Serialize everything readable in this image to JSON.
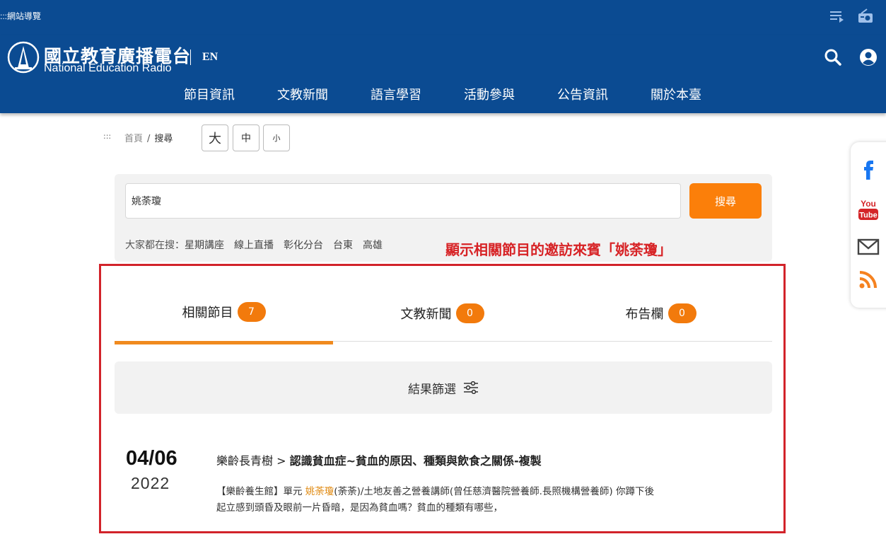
{
  "topbar": {
    "sitemap": ":::網站導覽"
  },
  "header": {
    "logo_zh": "國立教育廣播電台",
    "logo_en": "National Education Radio",
    "lang": "EN",
    "nav": [
      "節目資訊",
      "文教新聞",
      "語言學習",
      "活動參與",
      "公告資訊",
      "關於本臺"
    ]
  },
  "breadcrumb": {
    "dots": ":::",
    "home": "首頁",
    "sep": "/",
    "current": "搜尋"
  },
  "fontsize": {
    "large": "大",
    "medium": "中",
    "small": "小"
  },
  "search": {
    "value": "姚荼瓊",
    "button": "搜尋",
    "hot_label": "大家都在搜：",
    "hot_keywords": [
      "星期講座",
      "線上直播",
      "彰化分台",
      "台東",
      "高雄"
    ]
  },
  "annotation": "顯示相關節目的邀訪來賓「姚荼瓊」",
  "tabs": [
    {
      "label": "相關節目",
      "count": "7"
    },
    {
      "label": "文教新聞",
      "count": "0"
    },
    {
      "label": "布告欄",
      "count": "0"
    }
  ],
  "filter": {
    "label": "結果篩選"
  },
  "result": {
    "date_md": "04/06",
    "date_y": "2022",
    "program": "樂齡長青樹",
    "arrow": " > ",
    "title": "認識貧血症~貧血的原因、種類與飲食之關係-複製",
    "desc_pre": "【樂齡養生館】單元 ",
    "desc_hl": "姚荼瓊",
    "desc_post": "(荼荼)/土地友善之營養講師(曾任慈濟醫院營養師.長照機構營養師) 你蹲下後起立感到頭昏及眼前一片昏暗，是因為貧血嗎？貧血的種類有哪些，"
  },
  "colors": {
    "brand_blue": "#0b4b92",
    "accent_orange": "#fb7f0a",
    "annotation_red": "#d72326"
  }
}
